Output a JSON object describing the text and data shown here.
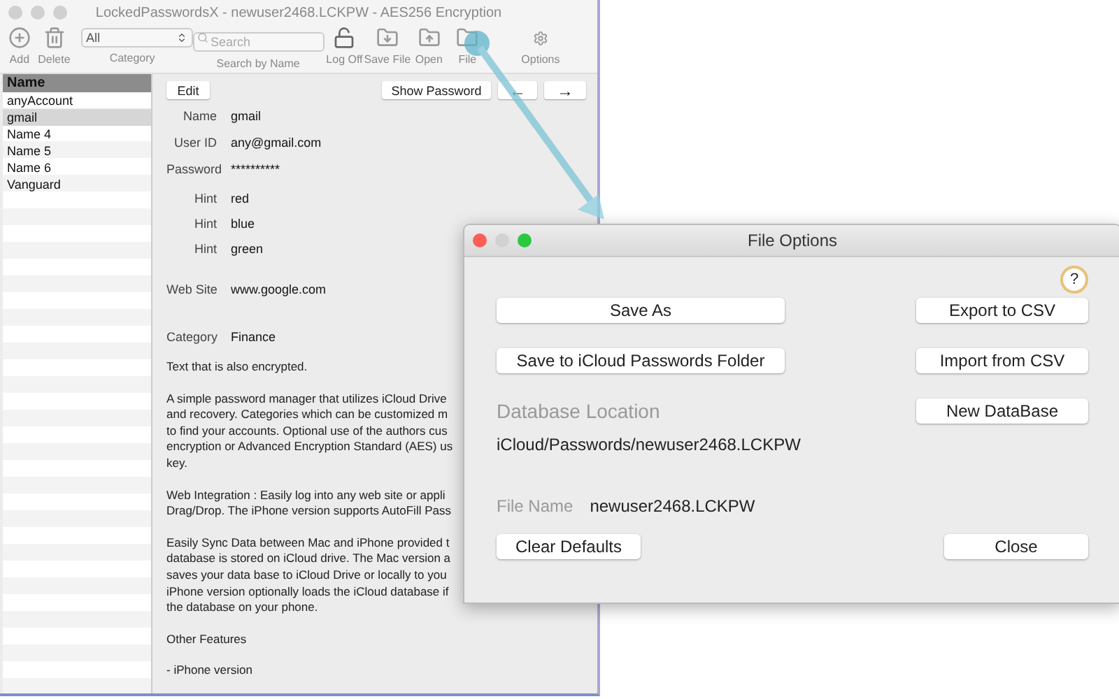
{
  "main_window": {
    "title": "LockedPasswordsX - newuser2468.LCKPW -  AES256  Encryption",
    "toolbar": [
      {
        "kind": "button",
        "label": "Add"
      },
      {
        "kind": "button",
        "label": "Delete"
      },
      {
        "kind": "select",
        "label": "Category",
        "value": "All"
      },
      {
        "kind": "search",
        "label": "Search by Name",
        "placeholder": "Search"
      },
      {
        "kind": "button",
        "label": "Log Off"
      },
      {
        "kind": "button",
        "label": "Save File"
      },
      {
        "kind": "button",
        "label": "Open"
      },
      {
        "kind": "button",
        "label": "File"
      },
      {
        "kind": "button",
        "label": "Options"
      }
    ],
    "list": {
      "header": "Name",
      "items": [
        {
          "label": "anyAccount",
          "selected": false
        },
        {
          "label": "gmail",
          "selected": true
        },
        {
          "label": "Name 4",
          "selected": false
        },
        {
          "label": "Name 5",
          "selected": false
        },
        {
          "label": "Name 6",
          "selected": false
        },
        {
          "label": "Vanguard",
          "selected": false
        }
      ]
    },
    "buttons": {
      "edit": "Edit",
      "show_password": "Show Password",
      "previous": "←",
      "next": "→"
    },
    "fields": [
      {
        "label": "Name",
        "value": "gmail"
      },
      {
        "label": "User ID",
        "value": "any@gmail.com"
      },
      {
        "label": "Password",
        "value": "**********"
      },
      {
        "label": "Hint",
        "value": "red"
      },
      {
        "label": "Hint",
        "value": "blue"
      },
      {
        "label": "Hint",
        "value": "green"
      },
      {
        "label": "Web Site",
        "value": "www.google.com"
      },
      {
        "label": "Category",
        "value": "Finance"
      }
    ],
    "notes": [
      [
        "Text that is also encrypted."
      ],
      [
        "A simple password manager that utilizes iCloud Drive",
        "and recovery.  Categories which can be customized m",
        "to find your accounts. Optional use of the authors cus",
        "encryption or Advanced Encryption Standard (AES) us",
        "key."
      ],
      [
        "Web Integration : Easily log into any web site or appli",
        "Drag/Drop. The iPhone version supports AutoFill Pass"
      ],
      [
        "Easily Sync Data between Mac and iPhone provided t",
        "database is stored on iCloud drive. The Mac version a",
        "saves your data base to iCloud Drive or locally to you",
        "iPhone version optionally loads the iCloud database if",
        "the database on your phone."
      ],
      [
        "Other Features"
      ],
      [
        "-  iPhone version"
      ]
    ]
  },
  "dialog": {
    "title": "File Options",
    "help": "?",
    "save_as": "Save As",
    "export_csv": "Export to CSV",
    "save_icloud": "Save to iCloud Passwords Folder",
    "import_csv": "Import from CSV",
    "location_label": "Database Location",
    "new_database": "New DataBase",
    "location": "iCloud/Passwords/newuser2468.LCKPW",
    "file_name_label": "File Name",
    "file_name": "newuser2468.LCKPW",
    "clear_defaults": "Clear Defaults",
    "close": "Close"
  }
}
